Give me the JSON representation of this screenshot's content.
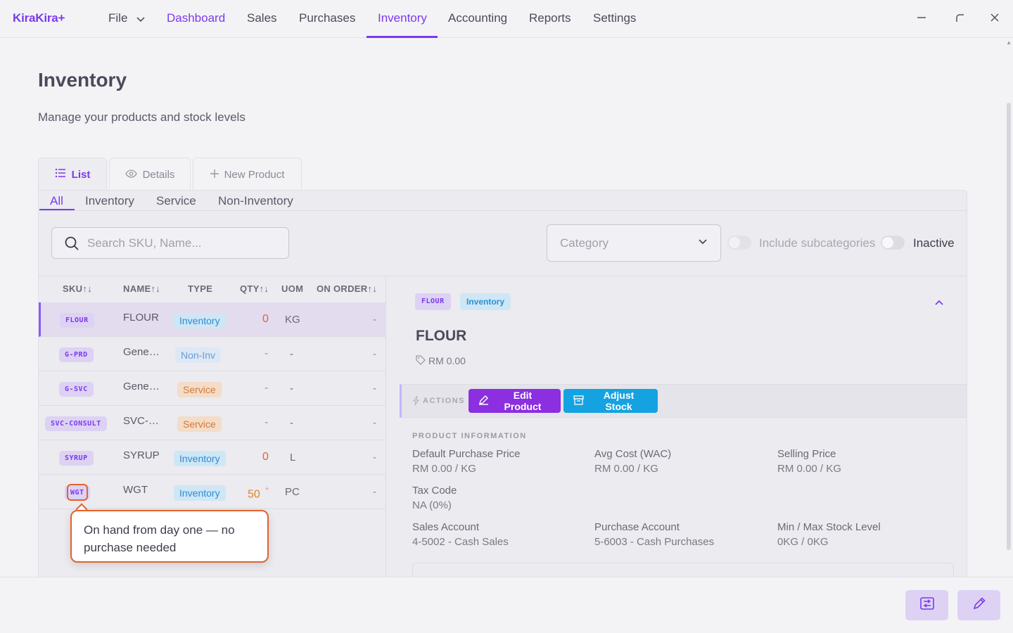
{
  "app": {
    "logo": "KiraKira+"
  },
  "nav": {
    "file": "File",
    "items": [
      "Dashboard",
      "Sales",
      "Purchases",
      "Inventory",
      "Accounting",
      "Reports",
      "Settings"
    ],
    "active": "Inventory"
  },
  "page": {
    "title": "Inventory",
    "subtitle": "Manage your products and stock levels"
  },
  "tabs": {
    "list": "List",
    "details": "Details",
    "new_product": "New Product"
  },
  "subtabs": [
    "All",
    "Inventory",
    "Service",
    "Non-Inventory"
  ],
  "filters": {
    "search_placeholder": "Search SKU, Name...",
    "category_placeholder": "Category",
    "include_subcategories": "Include subcategories",
    "inactive": "Inactive"
  },
  "table": {
    "headers": {
      "sku": "SKU↑↓",
      "name": "NAME↑↓",
      "type": "TYPE",
      "qty": "QTY↑↓",
      "uom": "UOM",
      "on_order": "ON ORDER↑↓"
    },
    "rows": [
      {
        "sku": "FLOUR",
        "name": "FLOUR",
        "type": "Inventory",
        "qty": "0",
        "uom": "KG",
        "on_order": "-"
      },
      {
        "sku": "G-PRD",
        "name": "Gene…",
        "type": "Non-Inv",
        "qty": "-",
        "uom": "-",
        "on_order": "-"
      },
      {
        "sku": "G-SVC",
        "name": "Gene…",
        "type": "Service",
        "qty": "-",
        "uom": "-",
        "on_order": "-"
      },
      {
        "sku": "SVC-CONSULT",
        "name": "SVC-…",
        "type": "Service",
        "qty": "-",
        "uom": "-",
        "on_order": "-"
      },
      {
        "sku": "SYRUP",
        "name": "SYRUP",
        "type": "Inventory",
        "qty": "0",
        "uom": "L",
        "on_order": "-"
      },
      {
        "sku": "WGT",
        "name": "WGT",
        "type": "Inventory",
        "qty": "50",
        "qty_mark": "*",
        "uom": "PC",
        "on_order": "-"
      }
    ]
  },
  "callout": {
    "text": "On hand from day one — no purchase needed"
  },
  "detail": {
    "sku": "FLOUR",
    "type": "Inventory",
    "title": "FLOUR",
    "price": "RM 0.00",
    "actions_label": "ACTIONS",
    "edit_button": "Edit Product",
    "adjust_button": "Adjust Stock",
    "info_heading": "PRODUCT INFORMATION",
    "fields": {
      "default_purchase_price_label": "Default Purchase Price",
      "default_purchase_price": "RM 0.00 / KG",
      "avg_cost_label": "Avg Cost (WAC)",
      "avg_cost": "RM 0.00 / KG",
      "selling_price_label": "Selling Price",
      "selling_price": "RM 0.00 / KG",
      "tax_code_label": "Tax Code",
      "tax_code": "NA (0%)",
      "sales_account_label": "Sales Account",
      "sales_account": "4-5002 - Cash Sales",
      "purchase_account_label": "Purchase Account",
      "purchase_account": "5-6003 - Cash Purchases",
      "min_max_label": "Min / Max Stock Level",
      "min_max": "0KG / 0KG"
    }
  },
  "colors": {
    "accent": "#7c3aed",
    "info": "#14a3e0",
    "warning": "#e3622a"
  }
}
